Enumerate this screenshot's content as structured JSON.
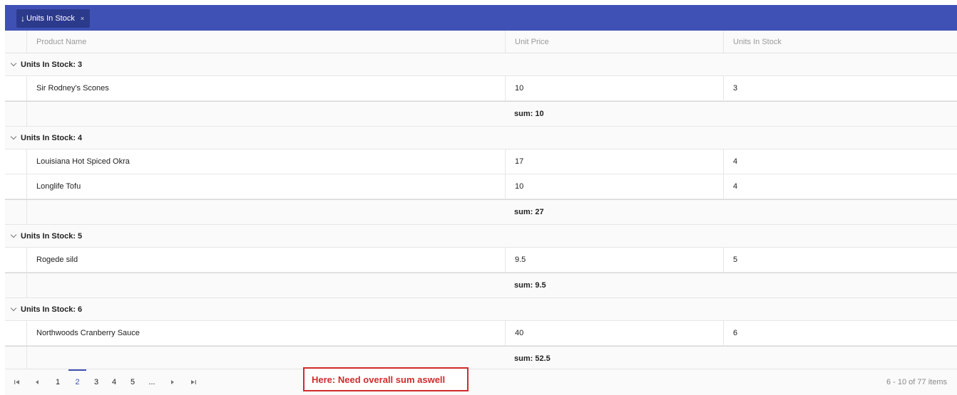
{
  "grouping": {
    "chip_arrow": "↓",
    "chip_label": "Units In Stock",
    "chip_close": "×"
  },
  "columns": [
    "Product Name",
    "Unit Price",
    "Units In Stock"
  ],
  "groups": [
    {
      "label": "Units In Stock: 3",
      "rows": [
        {
          "name": "Sir Rodney's Scones",
          "price": "10",
          "stock": "3"
        }
      ],
      "sum": "sum: 10"
    },
    {
      "label": "Units In Stock: 4",
      "rows": [
        {
          "name": "Louisiana Hot Spiced Okra",
          "price": "17",
          "stock": "4"
        },
        {
          "name": "Longlife Tofu",
          "price": "10",
          "stock": "4"
        }
      ],
      "sum": "sum: 27"
    },
    {
      "label": "Units In Stock: 5",
      "rows": [
        {
          "name": "Rogede sild",
          "price": "9.5",
          "stock": "5"
        }
      ],
      "sum": "sum: 9.5"
    },
    {
      "label": "Units In Stock: 6",
      "rows": [
        {
          "name": "Northwoods Cranberry Sauce",
          "price": "40",
          "stock": "6"
        }
      ],
      "sum": "sum: 52.5"
    }
  ],
  "pager": {
    "first_icon": "first-page-icon",
    "prev_icon": "previous-page-icon",
    "next_icon": "next-page-icon",
    "last_icon": "last-page-icon",
    "pages": [
      "1",
      "2",
      "3",
      "4",
      "5",
      "..."
    ],
    "selected_page": "2",
    "info": "6 - 10 of 77 items"
  },
  "annotation": {
    "text": "Here: Need overall sum aswell",
    "color": "#d22b2b"
  },
  "colors": {
    "accent": "#3f51b5",
    "chip": "#2c3a8c"
  }
}
